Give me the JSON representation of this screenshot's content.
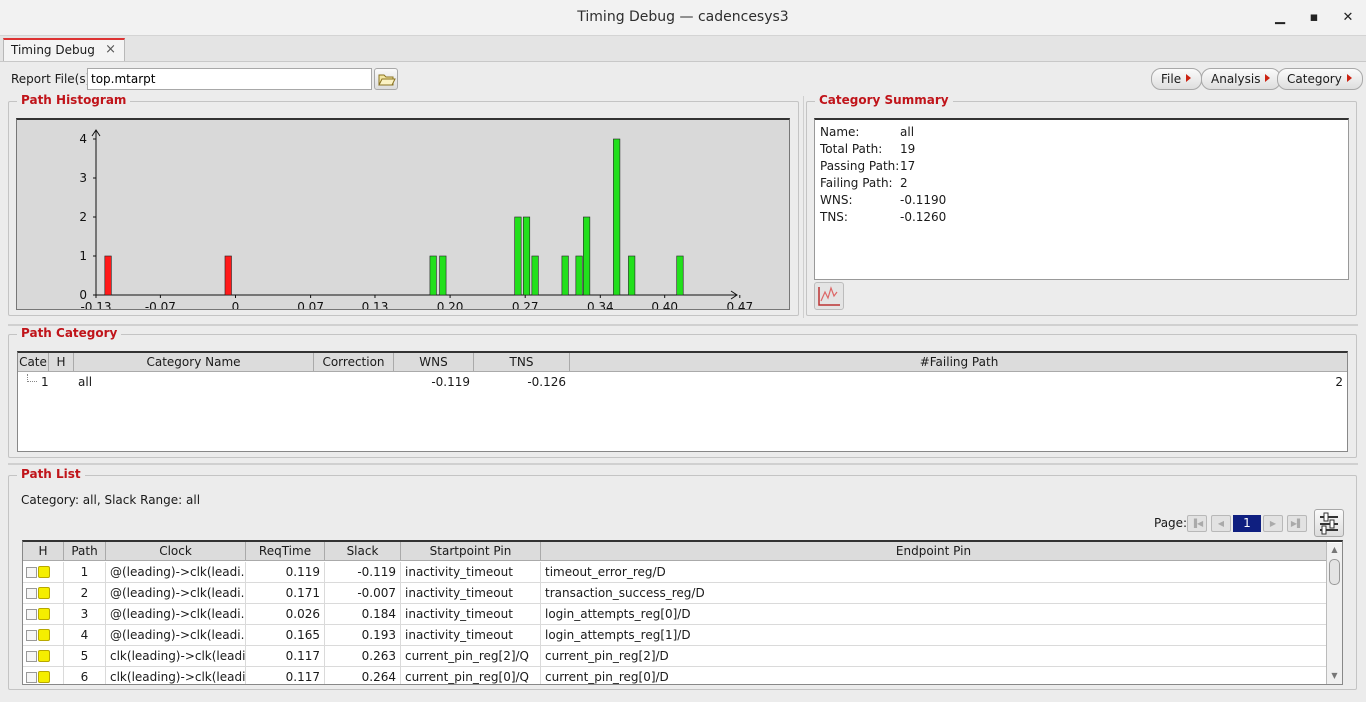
{
  "window": {
    "title": "Timing Debug — cadencesys3",
    "controls": {
      "minimize": "▁",
      "maximize": "▪",
      "close": "✕"
    }
  },
  "tab": {
    "label": "Timing Debug",
    "close": "×"
  },
  "toolbar": {
    "report_label": "Report File(s)",
    "report_value": "top.mtarpt",
    "menus": [
      "File",
      "Analysis",
      "Category"
    ]
  },
  "histogram": {
    "title": "Path Histogram",
    "chart_data": {
      "type": "bar",
      "x_ticks": [
        "-0.13",
        "-0.07",
        "0",
        "0.07",
        "0.13",
        "0.20",
        "0.27",
        "0.34",
        "0.40",
        "0.47"
      ],
      "x_tick_values": [
        -0.13,
        -0.07,
        0,
        0.07,
        0.13,
        0.2,
        0.27,
        0.34,
        0.4,
        0.47
      ],
      "y_ticks": [
        "0",
        "1",
        "2",
        "3",
        "4"
      ],
      "xlim": [
        -0.13,
        0.51
      ],
      "ylim": [
        0,
        4
      ],
      "bars": [
        {
          "x": -0.119,
          "value": 1,
          "status": "fail"
        },
        {
          "x": -0.007,
          "value": 1,
          "status": "fail"
        },
        {
          "x": 0.184,
          "value": 1,
          "status": "pass"
        },
        {
          "x": 0.193,
          "value": 1,
          "status": "pass"
        },
        {
          "x": 0.263,
          "value": 2,
          "status": "pass"
        },
        {
          "x": 0.271,
          "value": 2,
          "status": "pass"
        },
        {
          "x": 0.279,
          "value": 1,
          "status": "pass"
        },
        {
          "x": 0.307,
          "value": 1,
          "status": "pass"
        },
        {
          "x": 0.32,
          "value": 1,
          "status": "pass"
        },
        {
          "x": 0.327,
          "value": 2,
          "status": "pass"
        },
        {
          "x": 0.355,
          "value": 4,
          "status": "pass"
        },
        {
          "x": 0.369,
          "value": 1,
          "status": "pass"
        },
        {
          "x": 0.414,
          "value": 1,
          "status": "pass"
        }
      ],
      "colors": {
        "fail": "#ff1a1a",
        "pass": "#22e01c"
      }
    }
  },
  "summary": {
    "title": "Category Summary",
    "rows": [
      {
        "key": "Name:",
        "value": "all"
      },
      {
        "key": "Total Path:",
        "value": "19"
      },
      {
        "key": "Passing Path:",
        "value": "17"
      },
      {
        "key": "Failing Path:",
        "value": "2"
      },
      {
        "key": "WNS:",
        "value": "-0.1190"
      },
      {
        "key": "TNS:",
        "value": "-0.1260"
      }
    ]
  },
  "category": {
    "title": "Path Category",
    "headers": [
      "Cate",
      "H",
      "Category Name",
      "Correction",
      "WNS",
      "TNS",
      "#Failing Path"
    ],
    "rows": [
      {
        "id": "1",
        "name": "all",
        "correction": "",
        "wns": "-0.119",
        "tns": "-0.126",
        "failing": "2"
      }
    ]
  },
  "pathlist": {
    "title": "Path List",
    "info": "Category: all,   Slack Range: all",
    "page_label": "Page:",
    "page": "1",
    "headers": [
      "H",
      "Path",
      "Clock",
      "ReqTime",
      "Slack",
      "Startpoint Pin",
      "Endpoint Pin"
    ],
    "rows": [
      {
        "path": "1",
        "clock": "@(leading)->clk(leadi...",
        "req": "0.119",
        "slack": "-0.119",
        "start": "inactivity_timeout",
        "end": "timeout_error_reg/D"
      },
      {
        "path": "2",
        "clock": "@(leading)->clk(leadi...",
        "req": "0.171",
        "slack": "-0.007",
        "start": "inactivity_timeout",
        "end": "transaction_success_reg/D"
      },
      {
        "path": "3",
        "clock": "@(leading)->clk(leadi...",
        "req": "0.026",
        "slack": "0.184",
        "start": "inactivity_timeout",
        "end": "login_attempts_reg[0]/D"
      },
      {
        "path": "4",
        "clock": "@(leading)->clk(leadi...",
        "req": "0.165",
        "slack": "0.193",
        "start": "inactivity_timeout",
        "end": "login_attempts_reg[1]/D"
      },
      {
        "path": "5",
        "clock": "clk(leading)->clk(leadi...",
        "req": "0.117",
        "slack": "0.263",
        "start": "current_pin_reg[2]/Q",
        "end": "current_pin_reg[2]/D"
      },
      {
        "path": "6",
        "clock": "clk(leading)->clk(leadi...",
        "req": "0.117",
        "slack": "0.264",
        "start": "current_pin_reg[0]/Q",
        "end": "current_pin_reg[0]/D"
      }
    ]
  }
}
